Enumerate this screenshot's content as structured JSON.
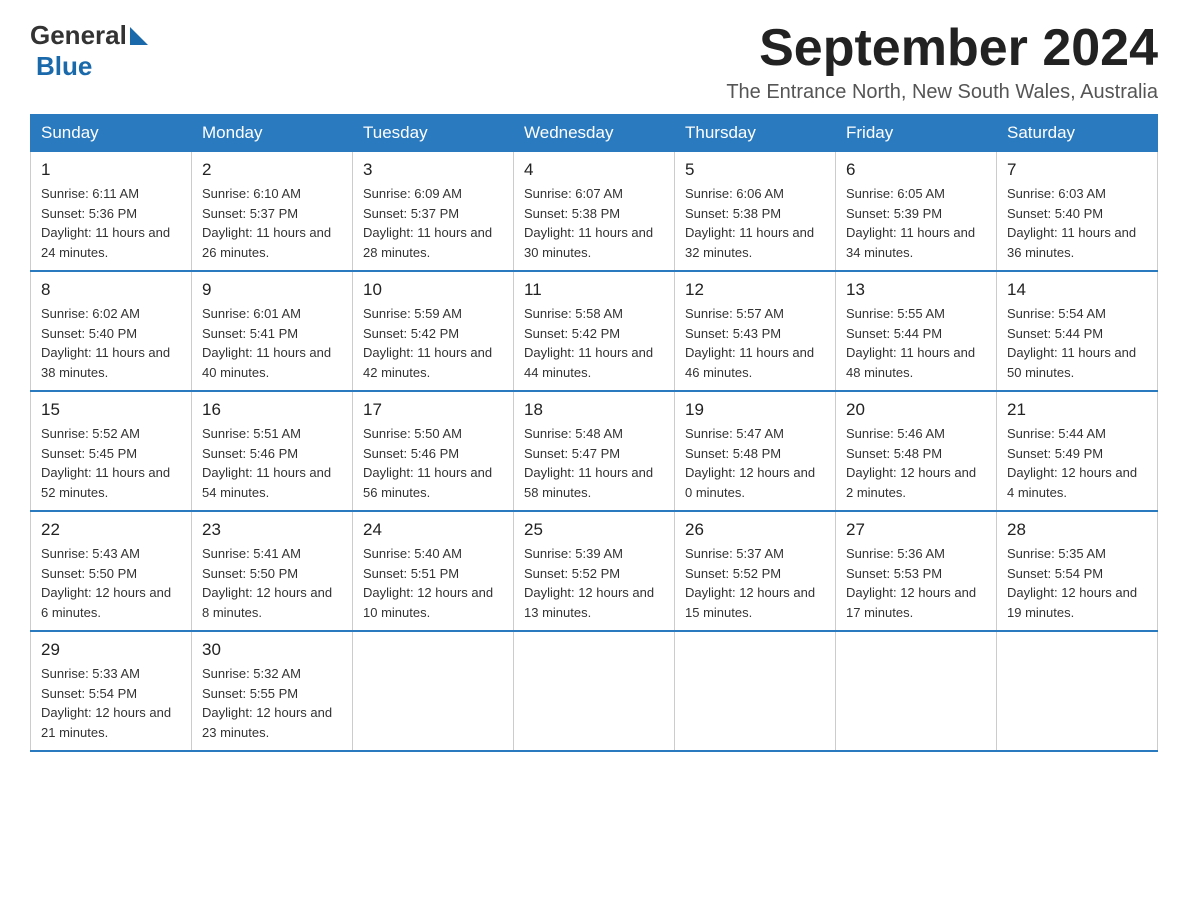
{
  "header": {
    "logo_general": "General",
    "logo_blue": "Blue",
    "month_title": "September 2024",
    "location": "The Entrance North, New South Wales, Australia"
  },
  "weekdays": [
    "Sunday",
    "Monday",
    "Tuesday",
    "Wednesday",
    "Thursday",
    "Friday",
    "Saturday"
  ],
  "weeks": [
    [
      {
        "day": "1",
        "sunrise": "Sunrise: 6:11 AM",
        "sunset": "Sunset: 5:36 PM",
        "daylight": "Daylight: 11 hours and 24 minutes."
      },
      {
        "day": "2",
        "sunrise": "Sunrise: 6:10 AM",
        "sunset": "Sunset: 5:37 PM",
        "daylight": "Daylight: 11 hours and 26 minutes."
      },
      {
        "day": "3",
        "sunrise": "Sunrise: 6:09 AM",
        "sunset": "Sunset: 5:37 PM",
        "daylight": "Daylight: 11 hours and 28 minutes."
      },
      {
        "day": "4",
        "sunrise": "Sunrise: 6:07 AM",
        "sunset": "Sunset: 5:38 PM",
        "daylight": "Daylight: 11 hours and 30 minutes."
      },
      {
        "day": "5",
        "sunrise": "Sunrise: 6:06 AM",
        "sunset": "Sunset: 5:38 PM",
        "daylight": "Daylight: 11 hours and 32 minutes."
      },
      {
        "day": "6",
        "sunrise": "Sunrise: 6:05 AM",
        "sunset": "Sunset: 5:39 PM",
        "daylight": "Daylight: 11 hours and 34 minutes."
      },
      {
        "day": "7",
        "sunrise": "Sunrise: 6:03 AM",
        "sunset": "Sunset: 5:40 PM",
        "daylight": "Daylight: 11 hours and 36 minutes."
      }
    ],
    [
      {
        "day": "8",
        "sunrise": "Sunrise: 6:02 AM",
        "sunset": "Sunset: 5:40 PM",
        "daylight": "Daylight: 11 hours and 38 minutes."
      },
      {
        "day": "9",
        "sunrise": "Sunrise: 6:01 AM",
        "sunset": "Sunset: 5:41 PM",
        "daylight": "Daylight: 11 hours and 40 minutes."
      },
      {
        "day": "10",
        "sunrise": "Sunrise: 5:59 AM",
        "sunset": "Sunset: 5:42 PM",
        "daylight": "Daylight: 11 hours and 42 minutes."
      },
      {
        "day": "11",
        "sunrise": "Sunrise: 5:58 AM",
        "sunset": "Sunset: 5:42 PM",
        "daylight": "Daylight: 11 hours and 44 minutes."
      },
      {
        "day": "12",
        "sunrise": "Sunrise: 5:57 AM",
        "sunset": "Sunset: 5:43 PM",
        "daylight": "Daylight: 11 hours and 46 minutes."
      },
      {
        "day": "13",
        "sunrise": "Sunrise: 5:55 AM",
        "sunset": "Sunset: 5:44 PM",
        "daylight": "Daylight: 11 hours and 48 minutes."
      },
      {
        "day": "14",
        "sunrise": "Sunrise: 5:54 AM",
        "sunset": "Sunset: 5:44 PM",
        "daylight": "Daylight: 11 hours and 50 minutes."
      }
    ],
    [
      {
        "day": "15",
        "sunrise": "Sunrise: 5:52 AM",
        "sunset": "Sunset: 5:45 PM",
        "daylight": "Daylight: 11 hours and 52 minutes."
      },
      {
        "day": "16",
        "sunrise": "Sunrise: 5:51 AM",
        "sunset": "Sunset: 5:46 PM",
        "daylight": "Daylight: 11 hours and 54 minutes."
      },
      {
        "day": "17",
        "sunrise": "Sunrise: 5:50 AM",
        "sunset": "Sunset: 5:46 PM",
        "daylight": "Daylight: 11 hours and 56 minutes."
      },
      {
        "day": "18",
        "sunrise": "Sunrise: 5:48 AM",
        "sunset": "Sunset: 5:47 PM",
        "daylight": "Daylight: 11 hours and 58 minutes."
      },
      {
        "day": "19",
        "sunrise": "Sunrise: 5:47 AM",
        "sunset": "Sunset: 5:48 PM",
        "daylight": "Daylight: 12 hours and 0 minutes."
      },
      {
        "day": "20",
        "sunrise": "Sunrise: 5:46 AM",
        "sunset": "Sunset: 5:48 PM",
        "daylight": "Daylight: 12 hours and 2 minutes."
      },
      {
        "day": "21",
        "sunrise": "Sunrise: 5:44 AM",
        "sunset": "Sunset: 5:49 PM",
        "daylight": "Daylight: 12 hours and 4 minutes."
      }
    ],
    [
      {
        "day": "22",
        "sunrise": "Sunrise: 5:43 AM",
        "sunset": "Sunset: 5:50 PM",
        "daylight": "Daylight: 12 hours and 6 minutes."
      },
      {
        "day": "23",
        "sunrise": "Sunrise: 5:41 AM",
        "sunset": "Sunset: 5:50 PM",
        "daylight": "Daylight: 12 hours and 8 minutes."
      },
      {
        "day": "24",
        "sunrise": "Sunrise: 5:40 AM",
        "sunset": "Sunset: 5:51 PM",
        "daylight": "Daylight: 12 hours and 10 minutes."
      },
      {
        "day": "25",
        "sunrise": "Sunrise: 5:39 AM",
        "sunset": "Sunset: 5:52 PM",
        "daylight": "Daylight: 12 hours and 13 minutes."
      },
      {
        "day": "26",
        "sunrise": "Sunrise: 5:37 AM",
        "sunset": "Sunset: 5:52 PM",
        "daylight": "Daylight: 12 hours and 15 minutes."
      },
      {
        "day": "27",
        "sunrise": "Sunrise: 5:36 AM",
        "sunset": "Sunset: 5:53 PM",
        "daylight": "Daylight: 12 hours and 17 minutes."
      },
      {
        "day": "28",
        "sunrise": "Sunrise: 5:35 AM",
        "sunset": "Sunset: 5:54 PM",
        "daylight": "Daylight: 12 hours and 19 minutes."
      }
    ],
    [
      {
        "day": "29",
        "sunrise": "Sunrise: 5:33 AM",
        "sunset": "Sunset: 5:54 PM",
        "daylight": "Daylight: 12 hours and 21 minutes."
      },
      {
        "day": "30",
        "sunrise": "Sunrise: 5:32 AM",
        "sunset": "Sunset: 5:55 PM",
        "daylight": "Daylight: 12 hours and 23 minutes."
      },
      null,
      null,
      null,
      null,
      null
    ]
  ]
}
